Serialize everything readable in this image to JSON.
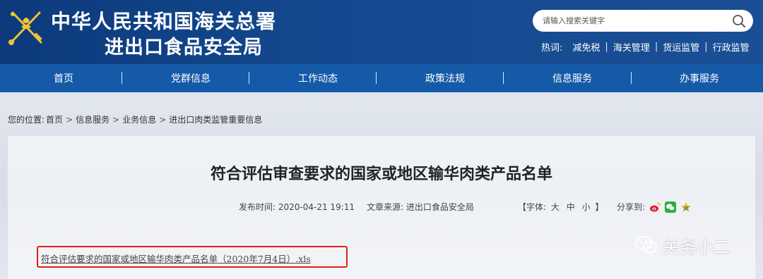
{
  "header": {
    "title_line1": "中华人民共和国海关总署",
    "title_line2": "进出口食品安全局",
    "search_placeholder": "请输入搜索关键字",
    "hot_label": "热词:",
    "hot_words": [
      "减免税",
      "海关管理",
      "货运监管",
      "行政监管"
    ],
    "emblem_icon": "customs-emblem-icon",
    "search_icon": "search-icon"
  },
  "nav": {
    "items": [
      "首页",
      "党群信息",
      "工作动态",
      "政策法规",
      "信息服务",
      "办事服务"
    ]
  },
  "breadcrumb": {
    "prefix": "您的位置:",
    "items": [
      "首页",
      "信息服务",
      "业务信息",
      "进出口肉类监管重要信息"
    ]
  },
  "article": {
    "title": "符合评估审查要求的国家或地区输华肉类产品名单",
    "publish_label": "发布时间:",
    "publish_time": "2020-04-21 19:11",
    "source_label": "文章来源:",
    "source": "进出口食品安全局",
    "font_label_open": "【字体:",
    "font_sizes": [
      "大",
      "中",
      "小"
    ],
    "font_label_close": "】",
    "share_label": "分享到:",
    "share_icons": [
      "weibo-icon",
      "wechat-icon",
      "qzone-icon"
    ],
    "attachment": "符合评估要求的国家或地区输华肉类产品名单（2020年7月4日）.xls"
  },
  "watermark": {
    "text": "关务小二",
    "icon": "wechat-logo-icon"
  },
  "colors": {
    "header_bg": "#15498f",
    "nav_bg": "#155aa8",
    "highlight_border": "#e0201b"
  }
}
